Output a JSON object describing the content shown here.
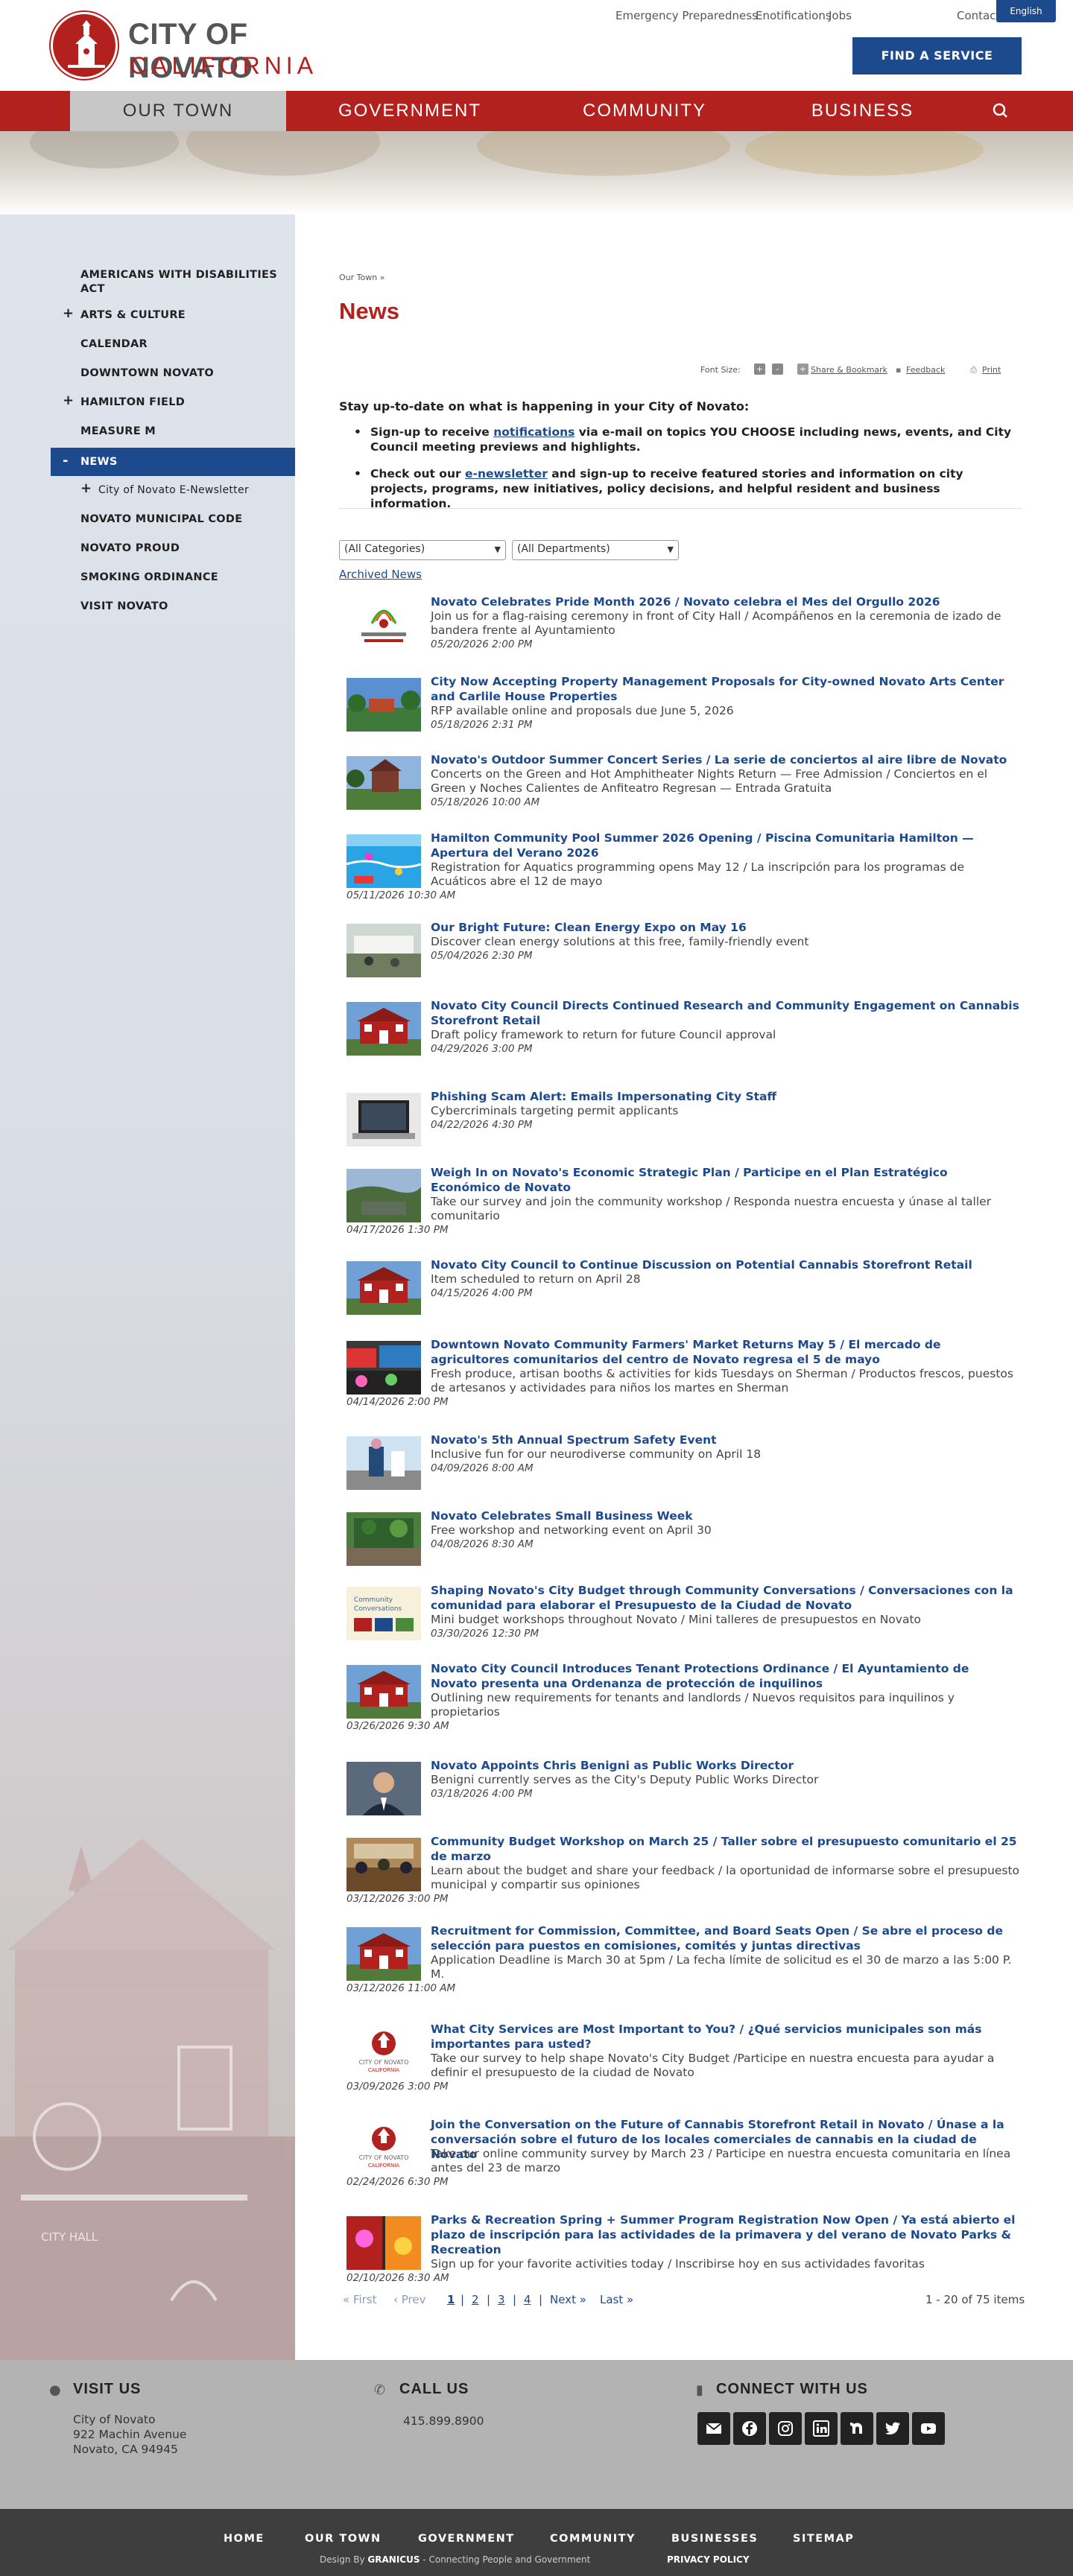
{
  "brand": {
    "line1": "CITY OF NOVATO",
    "line2": "CALIFORNIA",
    "accent_color": "#b3211e",
    "primary_color": "#1d4a8c"
  },
  "utility": {
    "links": [
      "Emergency Preparedness",
      "Enotifications",
      "Jobs",
      "Contact"
    ],
    "language": "English",
    "find_service": "FIND A SERVICE"
  },
  "mainnav": {
    "items": [
      "OUR TOWN",
      "GOVERNMENT",
      "COMMUNITY",
      "BUSINESS"
    ],
    "active": "OUR TOWN",
    "search_icon": "search-icon"
  },
  "sidebar": {
    "items": [
      {
        "label": "AMERICANS WITH DISABILITIES ACT",
        "expandable": false
      },
      {
        "label": "ARTS & CULTURE",
        "expandable": true
      },
      {
        "label": "CALENDAR",
        "expandable": false
      },
      {
        "label": "DOWNTOWN NOVATO",
        "expandable": false
      },
      {
        "label": "HAMILTON FIELD",
        "expandable": true
      },
      {
        "label": "MEASURE M",
        "expandable": false
      },
      {
        "label": "NEWS",
        "expandable": true,
        "active": true,
        "toggle": "-"
      },
      {
        "label": "City of Novato E-Newsletter",
        "expandable": true,
        "sub": true
      },
      {
        "label": "NOVATO MUNICIPAL CODE",
        "expandable": false
      },
      {
        "label": "NOVATO PROUD",
        "expandable": false
      },
      {
        "label": "SMOKING ORDINANCE",
        "expandable": false
      },
      {
        "label": "VISIT NOVATO",
        "expandable": false
      }
    ],
    "plus_symbol": "+"
  },
  "content": {
    "breadcrumb": "Our Town »",
    "title": "News",
    "tools": {
      "font_size": "Font Size:",
      "plus": "+",
      "minus": "-",
      "share": "Share & Bookmark",
      "feedback": "Feedback",
      "print": "Print"
    },
    "intro": "Stay up-to-date on what is happening in your City of Novato:",
    "bullet1": {
      "before": "Sign-up to receive ",
      "link": "notifications",
      "after": " via e-mail on topics YOU CHOOSE including news, events, and City Council meeting previews and highlights."
    },
    "bullet2": {
      "before": "Check out our ",
      "link": "e-newsletter",
      "after": " and sign-up to receive featured stories and information on city projects, programs, new initiatives, policy decisions, and helpful resident and business information."
    },
    "filters": {
      "categories": "(All Categories)",
      "departments": "(All Departments)"
    },
    "archived": "Archived News"
  },
  "news": [
    {
      "title": "Novato Celebrates Pride Month 2026 / Novato celebra el Mes del Orgullo 2026",
      "desc": "Join us for a flag-raising ceremony in front of City Hall / Acompáñenos en la ceremonia de izado de bandera frente al Ayuntamiento",
      "date": "05/20/2026 2:00 PM",
      "thumb": "pride"
    },
    {
      "title": "City Now Accepting Property Management Proposals for City-owned Novato Arts Center and Carlile House Properties",
      "desc": "RFP available online and proposals due June 5, 2026",
      "date": "05/18/2026 2:31 PM",
      "thumb": "park"
    },
    {
      "title": "Novato's Outdoor Summer Concert Series / La serie de conciertos al aire libre de Novato",
      "desc": "Concerts on the Green and Hot Amphitheater Nights Return — Free Admission / Conciertos en el Green y Noches Calientes de Anfiteatro Regresan — Entrada Gratuita",
      "date": "05/18/2026 10:00 AM",
      "thumb": "concert"
    },
    {
      "title": "Hamilton Community Pool Summer 2026 Opening / Piscina Comunitaria Hamilton — Apertura del Verano 2026",
      "desc": "Registration for Aquatics programming opens May 12 / La inscripción para los programas de Acuáticos abre el 12 de mayo",
      "date": "05/11/2026 10:30 AM",
      "thumb": "pool"
    },
    {
      "title": "Our Bright Future: Clean Energy Expo on May 16",
      "desc": "Discover clean energy solutions at this free, family-friendly event",
      "date": "05/04/2026 2:30 PM",
      "thumb": "expo"
    },
    {
      "title": "Novato City Council Directs Continued Research and Community Engagement on Cannabis Storefront Retail",
      "desc": "Draft policy framework to return for future Council approval",
      "date": "04/29/2026 3:00 PM",
      "thumb": "cityhall"
    },
    {
      "title": "Phishing Scam Alert: Emails Impersonating City Staff",
      "desc": "Cybercriminals targeting permit applicants",
      "date": "04/22/2026 4:30 PM",
      "thumb": "laptop"
    },
    {
      "title": "Weigh In on Novato's Economic Strategic Plan / Participe en el Plan Estratégico Económico de Novato",
      "desc": "Take our survey and join the community workshop / Responda nuestra encuesta y únase al taller comunitario",
      "date": "04/17/2026 1:30 PM",
      "thumb": "aerial"
    },
    {
      "title": "Novato City Council to Continue Discussion on Potential Cannabis Storefront Retail",
      "desc": "Item scheduled to return on April 28",
      "date": "04/15/2026 4:00 PM",
      "thumb": "cityhall"
    },
    {
      "title": "Downtown Novato Community Farmers' Market Returns May 5 / El mercado de agricultores comunitarios del centro de Novato regresa el 5 de mayo",
      "desc": "Fresh produce, artisan booths & activities for kids Tuesdays on Sherman / Productos frescos, puestos de artesanos y actividades para niños los martes en Sherman",
      "date": "04/14/2026 2:00 PM",
      "thumb": "market"
    },
    {
      "title": "Novato's 5th Annual Spectrum Safety Event",
      "desc": "Inclusive fun for our neurodiverse community on April 18",
      "date": "04/09/2026 8:00 AM",
      "thumb": "safety"
    },
    {
      "title": "Novato Celebrates Small Business Week",
      "desc": "Free workshop and networking event on April 30",
      "date": "04/08/2026 8:30 AM",
      "thumb": "shop"
    },
    {
      "title": "Shaping Novato's City Budget through Community Conversations / Conversaciones con la comunidad para elaborar el Presupuesto de la Ciudad de Novato",
      "desc": "Mini budget workshops throughout Novato / Mini talleres de presupuestos en Novato",
      "date": "03/30/2026 12:30 PM",
      "thumb": "budget"
    },
    {
      "title": "Novato City Council Introduces Tenant Protections Ordinance / El Ayuntamiento de Novato presenta una Ordenanza de protección de inquilinos",
      "desc": "Outlining new requirements for tenants and landlords / Nuevos requisitos para inquilinos y propietarios",
      "date": "03/26/2026 9:30 AM",
      "thumb": "cityhall"
    },
    {
      "title": "Novato Appoints Chris Benigni as Public Works Director",
      "desc": "Benigni currently serves as the City's Deputy Public Works Director",
      "date": "03/18/2026 4:00 PM",
      "thumb": "portrait"
    },
    {
      "title": "Community Budget Workshop on March 25 / Taller sobre el presupuesto comunitario el 25 de marzo",
      "desc": "Learn about the budget and share your feedback / la oportunidad de informarse sobre el presupuesto municipal y compartir sus opiniones",
      "date": "03/12/2026 3:00 PM",
      "thumb": "meeting"
    },
    {
      "title": "Recruitment for Commission, Committee, and Board Seats Open / Se abre el proceso de selección para puestos en comisiones, comités y juntas directivas",
      "desc": "Application Deadline is March 30 at 5pm / La fecha límite de solicitud es el 30 de marzo a las 5:00 P. M.",
      "date": "03/12/2026 11:00 AM",
      "thumb": "cityhall"
    },
    {
      "title": "What City Services are Most Important to You? / ¿Qué servicios municipales son más importantes para usted?",
      "desc": "Take our survey to help shape Novato's City Budget /Participe en nuestra encuesta para ayudar a definir el presupuesto de la ciudad de Novato",
      "date": "03/09/2026 3:00 PM",
      "thumb": "logo"
    },
    {
      "title": "Join the Conversation on the Future of Cannabis Storefront Retail in Novato / Únase a la conversación sobre el futuro de los locales comerciales de cannabis en la ciudad de Novato",
      "desc": "Take our online community survey by March 23 / Participe en nuestra encuesta comunitaria en línea antes del 23 de marzo",
      "date": "02/24/2026 6:30 PM",
      "thumb": "logo"
    },
    {
      "title": "Parks & Recreation Spring + Summer Program Registration Now Open / Ya está abierto el plazo de inscripción para las actividades de la primavera y del verano de Novato Parks & Recreation",
      "desc": "Sign up for your favorite activities today / Inscribirse hoy en sus actividades favoritas",
      "date": "02/10/2026 8:30 AM",
      "thumb": "guide"
    }
  ],
  "pager": {
    "first": "« First",
    "prev": "‹ Prev",
    "pages": [
      "1",
      "2",
      "3",
      "4"
    ],
    "current": "1",
    "next": "Next »",
    "last": "Last »",
    "count": "1 - 20 of 75 items"
  },
  "footer": {
    "visit_head": "VISIT US",
    "visit_lines": [
      "City of Novato",
      "922 Machin Avenue",
      "Novato, CA 94945"
    ],
    "call_head": "CALL US",
    "phone": "415.899.8900",
    "connect_head": "CONNECT WITH US",
    "social": [
      "email-icon",
      "facebook-icon",
      "instagram-icon",
      "linkedin-icon",
      "nextdoor-icon",
      "twitter-icon",
      "youtube-icon"
    ],
    "bottom_links": [
      "HOME",
      "OUR TOWN",
      "GOVERNMENT",
      "COMMUNITY",
      "BUSINESSES",
      "SITEMAP"
    ],
    "credit_prefix": "Design By",
    "credit_brand": "GRANICUS",
    "credit_suffix": "- Connecting People and Government",
    "privacy": "PRIVACY POLICY"
  }
}
